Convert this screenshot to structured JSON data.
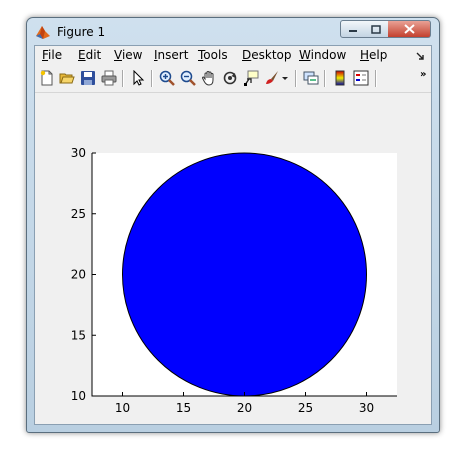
{
  "window": {
    "title": "Figure 1",
    "app_icon": "matlab-icon",
    "controls": {
      "minimize_icon": "minimize-icon",
      "maximize_icon": "maximize-icon",
      "close_icon": "close-icon"
    }
  },
  "menu": {
    "items": [
      {
        "mnemonic": "F",
        "rest": "ile"
      },
      {
        "mnemonic": "E",
        "rest": "dit"
      },
      {
        "mnemonic": "V",
        "rest": "iew"
      },
      {
        "mnemonic": "I",
        "rest": "nsert"
      },
      {
        "mnemonic": "T",
        "rest": "ools"
      },
      {
        "mnemonic": "D",
        "rest": "esktop"
      },
      {
        "mnemonic": "W",
        "rest": "indow"
      },
      {
        "mnemonic": "H",
        "rest": "elp"
      }
    ],
    "dock_icon": "dock-arrow-icon"
  },
  "toolbar": {
    "buttons": [
      "new-figure-icon",
      "open-file-icon",
      "save-icon",
      "print-icon",
      "select-pointer-icon",
      "zoom-in-icon",
      "zoom-out-icon",
      "pan-hand-icon",
      "rotate-3d-icon",
      "data-cursor-icon",
      "brush-icon",
      "link-plot-icon",
      "colorbar-icon",
      "legend-icon"
    ],
    "overflow": "»"
  },
  "chart_data": {
    "type": "area",
    "shape": "circle",
    "center": [
      20,
      20
    ],
    "radius": 10,
    "fill": "#0000ff",
    "edge": "#000000",
    "xlim": [
      7.5,
      32.5
    ],
    "ylim": [
      10,
      30
    ],
    "xticks": [
      10,
      15,
      20,
      25,
      30
    ],
    "yticks": [
      10,
      15,
      20,
      25,
      30
    ],
    "xtick_labels": [
      "10",
      "15",
      "20",
      "25",
      "30"
    ],
    "ytick_labels": [
      "10",
      "15",
      "20",
      "25",
      "30"
    ],
    "title": "",
    "xlabel": "",
    "ylabel": "",
    "grid": false,
    "axes_background": "#ffffff"
  }
}
